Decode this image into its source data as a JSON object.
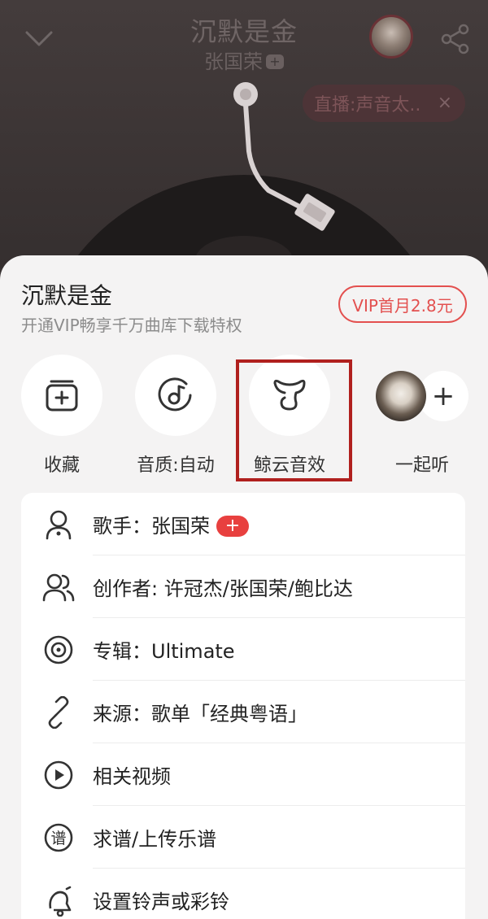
{
  "player": {
    "song_title": "沉默是金",
    "artist": "张国荣",
    "artist_plus": "+",
    "live_label": "直播:声音太..",
    "live_close": "×"
  },
  "sheet": {
    "title": "沉默是金",
    "subtitle": "开通VIP畅享千万曲库下载特权",
    "vip_button": "VIP首月2.8元"
  },
  "actions": [
    {
      "label": "收藏",
      "icon": "add-to-collection-icon"
    },
    {
      "label": "音质:自动",
      "icon": "audio-quality-icon"
    },
    {
      "label": "鲸云音效",
      "icon": "whale-cloud-sound-effect-icon"
    },
    {
      "label": "一起听",
      "icon": "listen-together-icon",
      "plus": "+"
    }
  ],
  "info": {
    "singer": "歌手：张国荣",
    "singer_plus": "+",
    "composer": "创作者: 许冠杰/张国荣/鲍比达",
    "album": "专辑：Ultimate",
    "source": "来源：歌单「经典粤语」",
    "video": "相关视频",
    "sheet_music": "求谱/上传乐谱",
    "ringtone": "设置铃声或彩铃",
    "sheet_music_icon_glyph": "谱"
  },
  "colors": {
    "accent_red": "#e3504f",
    "highlight_red": "#b0201e",
    "sheet_bg": "#f4f3f3",
    "player_bg": "#3a3434"
  }
}
